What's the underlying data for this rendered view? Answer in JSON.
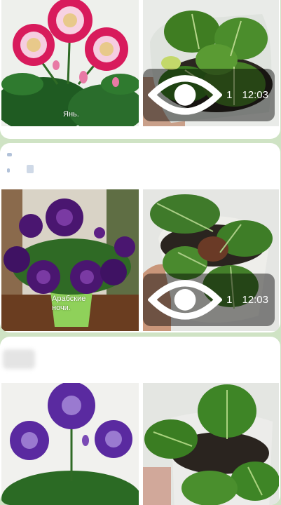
{
  "posts": [
    {
      "photo_left": {
        "caption": "Янь.",
        "description": "pink-gloxinia-photo"
      },
      "photo_right": {
        "description": "gloxinia-seedling-photo"
      },
      "views": "1",
      "time": "12:03"
    },
    {
      "photo_left": {
        "caption": "Арабские ночи.",
        "description": "purple-gloxinia-photo"
      },
      "photo_right": {
        "description": "gloxinia-seedling-photo"
      },
      "views": "1",
      "time": "12:03"
    },
    {
      "photo_left": {
        "caption": "",
        "description": "violet-gloxinia-photo"
      },
      "photo_right": {
        "description": "gloxinia-seedling-photo"
      }
    }
  ],
  "icons": {
    "views": "eye-icon"
  },
  "colors": {
    "background": "#cfe3c4",
    "bubble": "#ffffff",
    "overlay": "rgba(0,0,0,0.45)"
  }
}
